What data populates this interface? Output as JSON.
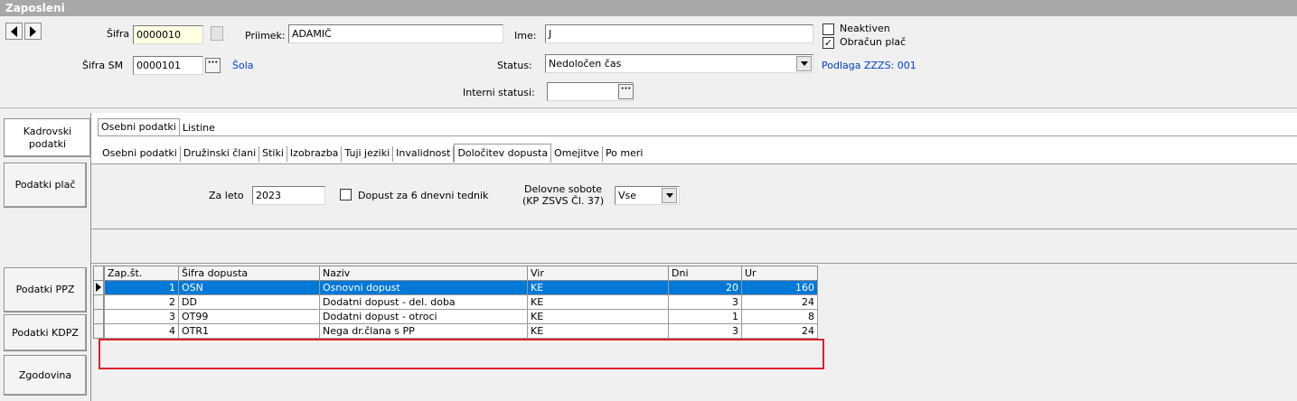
{
  "window": {
    "title": "Zaposleni"
  },
  "header": {
    "sifra_label": "Šifra",
    "sifra_value": "0000010",
    "priimek_label": "Priimek:",
    "priimek_value": "ADAMIČ",
    "ime_label": "Ime:",
    "ime_value": "J",
    "neaktiven_label": "Neaktiven",
    "neaktiven_checked": false,
    "obracun_label": "Obračun plač",
    "obracun_checked": true,
    "sifra_sm_label": "Šifra SM",
    "sifra_sm_value": "0000101",
    "sm_link": "Šola",
    "status_label": "Status:",
    "status_value": "Nedoločen čas",
    "podlaga_link": "Podlaga ZZZS: 001",
    "interni_label": "Interni statusi:",
    "interni_value": ""
  },
  "sidebar": {
    "items": [
      {
        "line1": "Kadrovski",
        "line2": "podatki"
      },
      {
        "line1": "Podatki plač",
        "line2": ""
      },
      {
        "line1": "Podatki  PPZ",
        "line2": ""
      },
      {
        "line1": "Podatki KDPZ",
        "line2": ""
      },
      {
        "line1": "Zgodovina",
        "line2": ""
      }
    ]
  },
  "tabs_main": [
    "Osebni podatki",
    "Listine"
  ],
  "tabs_sub": [
    "Osebni podatki",
    "Družinski člani",
    "Stiki",
    "Izobrazba",
    "Tuji jeziki",
    "Invalidnost",
    "Določitev dopusta",
    "Omejitve",
    "Po meri"
  ],
  "dopust": {
    "za_leto_label": "Za leto",
    "za_leto_value": "2023",
    "dopust6_label": "Dopust za 6 dnevni tednik",
    "dopust6_checked": false,
    "sobote_label1": "Delovne sobote",
    "sobote_label2": "(KP ZSVS Čl. 37)",
    "sobote_value": "Vse"
  },
  "grid": {
    "columns": [
      "Zap.št.",
      "Šifra dopusta",
      "Naziv",
      "Vir",
      "Dni",
      "Ur"
    ],
    "rows": [
      [
        "1",
        "OSN",
        "Osnovni dopust",
        "KE",
        "20",
        "160"
      ],
      [
        "2",
        "DD",
        "Dodatni dopust - del. doba",
        "KE",
        "3",
        "24"
      ],
      [
        "3",
        "OT99",
        "Dodatni dopust - otroci",
        "KE",
        "1",
        "8"
      ],
      [
        "4",
        "OTR1",
        "Nega dr.člana s PP",
        "KE",
        "3",
        "24"
      ]
    ],
    "selected_row": 0
  },
  "colors": {
    "selection": "#0078d7",
    "highlight_box": "#e0202a",
    "link": "#0040d0"
  }
}
